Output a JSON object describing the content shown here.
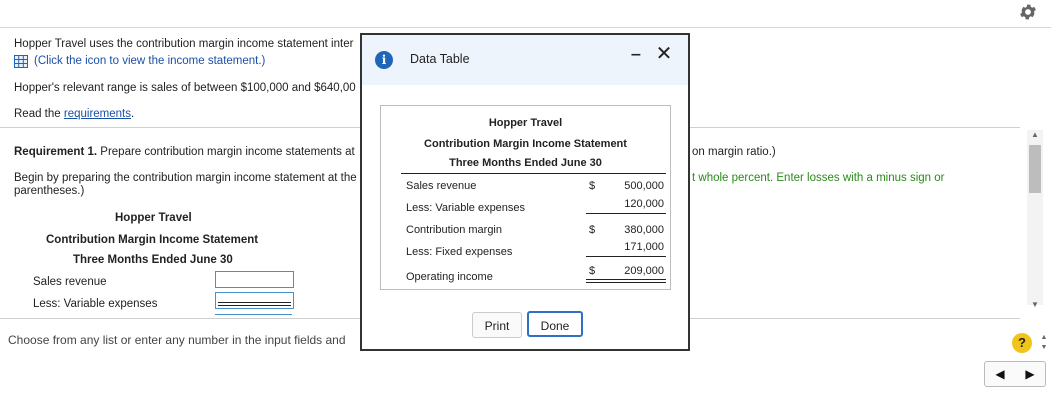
{
  "background": {
    "intro_text": "Hopper Travel uses the contribution margin income statement inter",
    "click_icon_text": "(Click the icon to view the income statement.)",
    "relevant_range_text": "Hopper's relevant range is sales of between $100,000 and $640,00",
    "read_prefix": "Read the ",
    "read_link": "requirements",
    "read_suffix": ".",
    "req_label": "Requirement 1.",
    "req_text": " Prepare contribution margin income statements at",
    "req_right_text": "on margin ratio.)",
    "begin_line1": "Begin by preparing the contribution margin income statement at the",
    "begin_line2": "parentheses.)",
    "begin_right_text": "t whole percent. Enter losses with a minus sign or",
    "stmt_company": "Hopper Travel",
    "stmt_title": "Contribution Margin Income Statement",
    "stmt_period": "Three Months Ended June 30",
    "row_sales": "Sales revenue",
    "row_variable": "Less: Variable expenses",
    "footer_text": "Choose from any list or enter any number in the input fields and"
  },
  "modal": {
    "title": "Data Table",
    "company": "Hopper Travel",
    "statement_title": "Contribution Margin Income Statement",
    "period": "Three Months Ended June 30",
    "rows": [
      {
        "label": "Sales revenue",
        "currency": "$",
        "value": "500,000"
      },
      {
        "label": "Less: Variable expenses",
        "currency": "",
        "value": "120,000"
      },
      {
        "label": "Contribution margin",
        "currency": "$",
        "value": "380,000"
      },
      {
        "label": "Less: Fixed expenses",
        "currency": "",
        "value": "171,000"
      },
      {
        "label": "Operating income",
        "currency": "$",
        "value": "209,000"
      }
    ],
    "print_label": "Print",
    "done_label": "Done"
  },
  "controls": {
    "help_label": "?"
  },
  "icons": {
    "settings": "gear-icon",
    "info": "info-icon",
    "table": "table-icon",
    "minimize": "minimize-icon",
    "close": "close-icon",
    "prev": "left-arrow-icon",
    "next": "right-arrow-icon"
  },
  "colors": {
    "link": "#1a4fa8",
    "hint": "#2a8a1a",
    "info_icon": "#2066b8",
    "done_border": "#2f6fc4",
    "help": "#f0c419"
  }
}
